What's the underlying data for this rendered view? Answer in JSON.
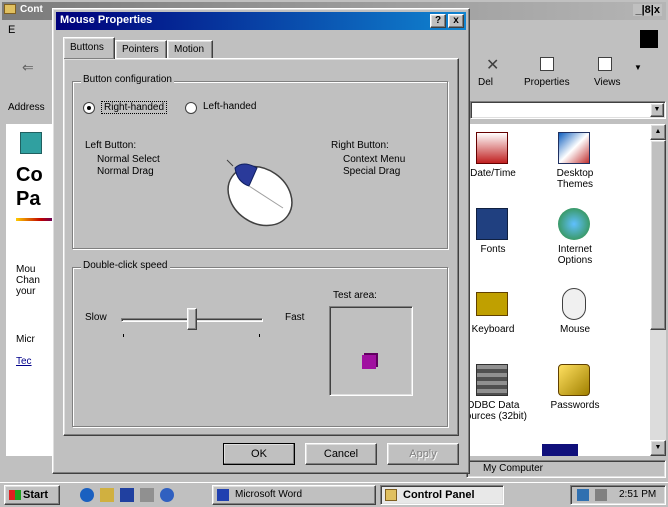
{
  "background_window": {
    "title": "Cont",
    "title_btn": "_|8|x",
    "menu_first": "E",
    "toolbar": [
      "Del",
      "Properties",
      "Views"
    ],
    "address_label": "Address",
    "left_panel": {
      "title_line1": "Co",
      "title_line2": "Pa",
      "text_lines": [
        "Mou",
        "Chan",
        "your"
      ],
      "link_lines": [
        "Micr",
        "Tec"
      ]
    },
    "icons": [
      {
        "name": "date-time-icon",
        "label": "Date/Time",
        "color": "#c02020"
      },
      {
        "name": "desktop-themes-icon",
        "label": "Desktop Themes",
        "color": "#1060c0"
      },
      {
        "name": "fonts-icon",
        "label": "Fonts",
        "color": "#204080"
      },
      {
        "name": "internet-options-icon",
        "label": "Internet Options",
        "color": "#2a8a2a"
      },
      {
        "name": "keyboard-icon",
        "label": "Keyboard",
        "color": "#c0a000"
      },
      {
        "name": "mouse-icon",
        "label": "Mouse",
        "color": "#808080"
      },
      {
        "name": "odbc-icon",
        "label": "ODBC Data Sources (32bit)",
        "color": "#505050"
      },
      {
        "name": "passwords-icon",
        "label": "Passwords",
        "color": "#a08000"
      }
    ],
    "status": "My Computer"
  },
  "dialog": {
    "title": "Mouse Properties",
    "title_help": "?",
    "title_close": "x",
    "tabs": [
      "Buttons",
      "Pointers",
      "Motion"
    ],
    "button_config": {
      "legend": "Button configuration",
      "right_handed": "Right-handed",
      "left_handed": "Left-handed",
      "left_button_title": "Left Button:",
      "left_button_items": [
        "Normal Select",
        "Normal Drag"
      ],
      "right_button_title": "Right Button:",
      "right_button_items": [
        "Context Menu",
        "Special Drag"
      ]
    },
    "double_click": {
      "legend": "Double-click speed",
      "slow": "Slow",
      "fast": "Fast",
      "test_area": "Test area:",
      "speed_fraction": 0.5
    },
    "buttons": {
      "ok": "OK",
      "cancel": "Cancel",
      "apply": "Apply"
    }
  },
  "taskbar": {
    "start": "Start",
    "tasks": [
      "Microsoft Word",
      "Control Panel"
    ],
    "clock": "2:51 PM"
  },
  "colors": {
    "accent": "#00007b",
    "purple_box": "#a010a0"
  }
}
